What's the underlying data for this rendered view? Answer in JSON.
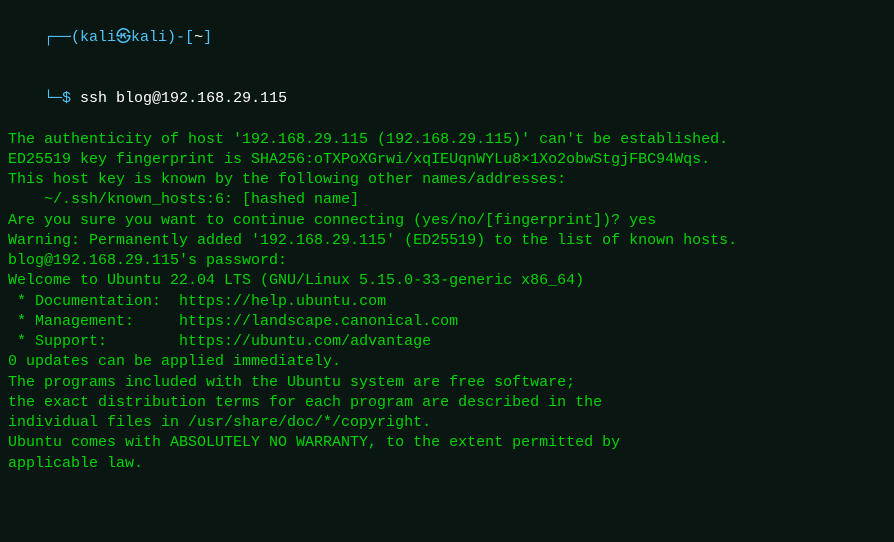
{
  "prompt": {
    "box_top_left": "┌──(",
    "user_host": "kali㉿kali",
    "box_top_right": ")-[",
    "path": "~",
    "box_top_close": "]",
    "box_bottom": "└─",
    "dollar": "$ ",
    "command": "ssh blog@192.168.29.115"
  },
  "lines": {
    "l1": "The authenticity of host '192.168.29.115 (192.168.29.115)' can't be established.",
    "l2": "ED25519 key fingerprint is SHA256:oTXPoXGrwi/xqIEUqnWYLu8×1Xo2obwStgjFBC94Wqs.",
    "l3": "This host key is known by the following other names/addresses:",
    "l4": "    ~/.ssh/known_hosts:6: [hashed name]",
    "l5": "Are you sure you want to continue connecting (yes/no/[fingerprint])? yes",
    "l6": "Warning: Permanently added '192.168.29.115' (ED25519) to the list of known hosts.",
    "l7": "blog@192.168.29.115's password:",
    "l8": "Welcome to Ubuntu 22.04 LTS (GNU/Linux 5.15.0-33-generic x86_64)",
    "l9": "",
    "l10": " * Documentation:  https://help.ubuntu.com",
    "l11": " * Management:     https://landscape.canonical.com",
    "l12": " * Support:        https://ubuntu.com/advantage",
    "l13": "",
    "l14": "0 updates can be applied immediately.",
    "l15": "",
    "l16": "",
    "l17": "The programs included with the Ubuntu system are free software;",
    "l18": "the exact distribution terms for each program are described in the",
    "l19": "individual files in /usr/share/doc/*/copyright.",
    "l20": "",
    "l21": "Ubuntu comes with ABSOLUTELY NO WARRANTY, to the extent permitted by",
    "l22": "applicable law."
  }
}
